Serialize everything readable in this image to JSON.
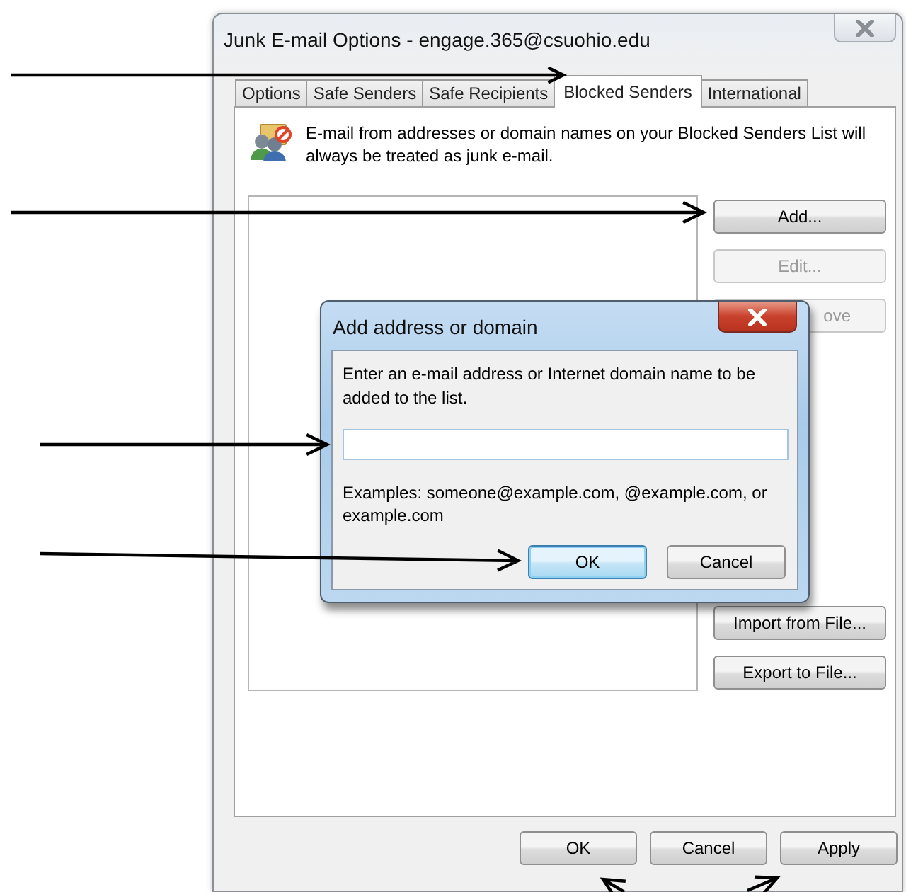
{
  "window": {
    "title": "Junk E-mail Options - engage.365@csuohio.edu",
    "tabs": [
      {
        "label": "Options",
        "selected": false
      },
      {
        "label": "Safe Senders",
        "selected": false
      },
      {
        "label": "Safe Recipients",
        "selected": false
      },
      {
        "label": "Blocked Senders",
        "selected": true
      },
      {
        "label": "International",
        "selected": false
      }
    ],
    "description": "E-mail from addresses or domain names on your Blocked Senders List will always be treated as junk e-mail.",
    "list_buttons": [
      {
        "label": "Add...",
        "disabled": false
      },
      {
        "label": "Edit...",
        "disabled": true
      },
      {
        "label": "ove",
        "disabled": true,
        "covered": true
      }
    ],
    "file_buttons": [
      {
        "label": "Import from File..."
      },
      {
        "label": "Export to File..."
      }
    ],
    "footer_buttons": [
      {
        "label": "OK"
      },
      {
        "label": "Cancel"
      },
      {
        "label": "Apply"
      }
    ]
  },
  "dialog": {
    "title": "Add address or domain",
    "prompt": "Enter an e-mail address or Internet domain name to be added to the list.",
    "examples": "Examples: someone@example.com, @example.com, or example.com",
    "buttons": [
      {
        "label": "OK",
        "focused": true
      },
      {
        "label": "Cancel",
        "focused": false
      }
    ]
  }
}
